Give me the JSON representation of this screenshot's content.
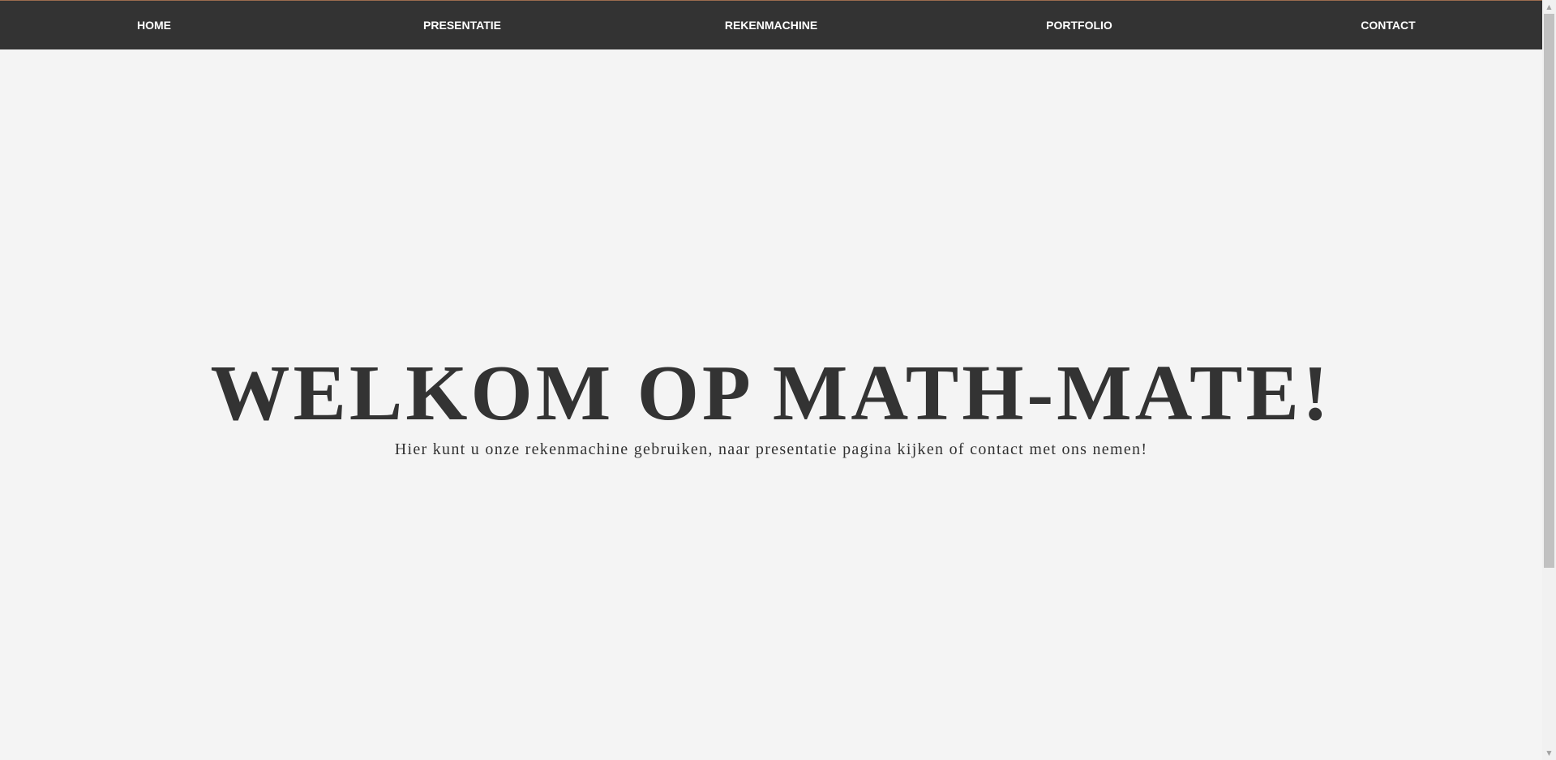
{
  "nav": {
    "items": [
      {
        "label": "HOME"
      },
      {
        "label": "PRESENTATIE"
      },
      {
        "label": "REKENMACHINE"
      },
      {
        "label": "PORTFOLIO"
      },
      {
        "label": "CONTACT"
      }
    ]
  },
  "hero": {
    "title": "WELKOM OP MATH-MATE!",
    "subtitle": "Hier kunt u onze rekenmachine gebruiken, naar presentatie pagina kijken of contact met ons nemen!"
  },
  "scrollbar": {
    "up_icon": "▲",
    "down_icon": "▼"
  },
  "colors": {
    "navbar_bg": "#333333",
    "page_bg": "#f4f4f4",
    "text": "#333333",
    "nav_text": "#ffffff"
  }
}
